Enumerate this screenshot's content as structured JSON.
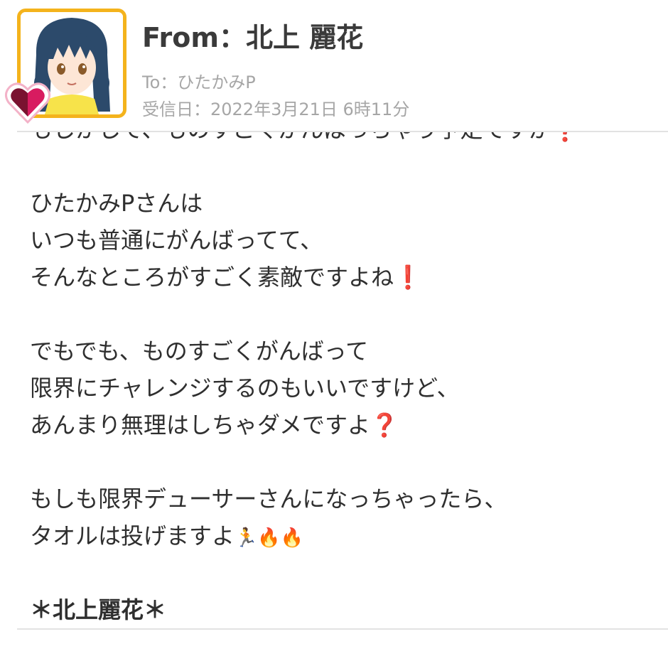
{
  "header": {
    "from_label": "From：北上 麗花",
    "to_label": "To：ひたかみP",
    "received_label": "受信日：2022年3月21日 6時11分"
  },
  "message": {
    "lines": [
      "もしかして、ものすごくがんばっちゃう予定ですか",
      "",
      "ひたかみPさんは",
      "いつも普通にがんばってて、",
      "そんなところがすごく素敵ですよね",
      "",
      "でもでも、ものすごくがんばって",
      "限界にチャレンジするのもいいですけど、",
      "あんまり無理はしちゃダメですよ",
      "",
      "もしも限界デューサーさんになっちゃったら、",
      "タオルは投げますよ",
      "",
      "＊北上麗花＊"
    ],
    "marks": {
      "question": "❓",
      "exclaim": "❗",
      "runner": "🏃",
      "fire": "🔥"
    }
  },
  "colors": {
    "avatar_border": "#f4b31c",
    "heart": "#c2185b",
    "text_gray": "#a6a6a6"
  }
}
